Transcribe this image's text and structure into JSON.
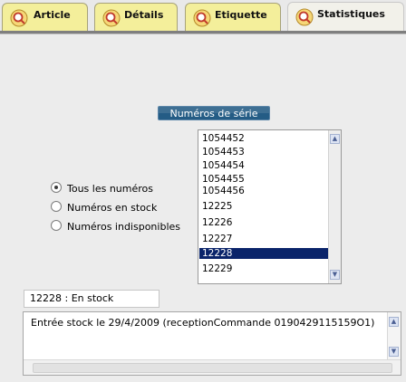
{
  "tabs": [
    {
      "label": "Article",
      "active": false,
      "icon": "magnifier-icon"
    },
    {
      "label": "Détails",
      "active": false,
      "icon": "magnifier-icon"
    },
    {
      "label": "Etiquette",
      "active": false,
      "icon": "magnifier-icon"
    },
    {
      "label": "Statistiques",
      "active": true,
      "icon": "magnifier-icon"
    }
  ],
  "serial_section": {
    "title": "Numéros de série",
    "filter_options": [
      {
        "label": "Tous les numéros",
        "selected": true
      },
      {
        "label": "Numéros en stock",
        "selected": false
      },
      {
        "label": "Numéros indisponibles",
        "selected": false
      }
    ],
    "serial_list": [
      "1054452",
      "1054453",
      "1054454",
      "1054455",
      "1054456",
      "12225",
      "12226",
      "12227",
      "12228",
      "12229"
    ],
    "selected_serial": "12228"
  },
  "status": {
    "text": "12228 : En stock"
  },
  "history": {
    "text": "Entrée stock le 29/4/2009 (receptionCommande 0190429115159O1)"
  },
  "colors": {
    "tab_bg": "#f4ef9b",
    "active_tab_bg": "#f2f1ea",
    "section_title_bg": "#245c85",
    "selection_bg": "#0a246a"
  }
}
